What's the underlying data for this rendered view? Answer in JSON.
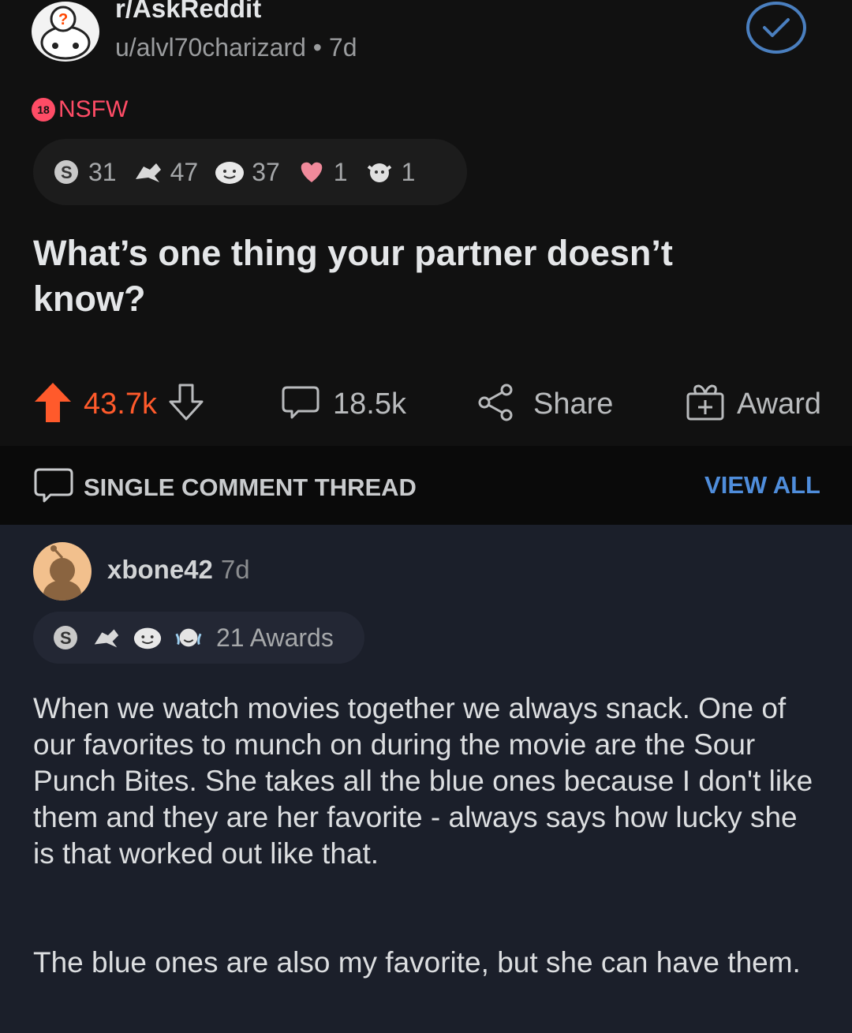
{
  "post": {
    "subreddit": "r/AskReddit",
    "author": "u/alvl70charizard",
    "separator": "•",
    "age": "7d",
    "nsfw_badge": "18",
    "nsfw_label": "NSFW",
    "awards": [
      {
        "icon": "silver-award-icon",
        "count": "31"
      },
      {
        "icon": "helpful-award-icon",
        "count": "47"
      },
      {
        "icon": "wholesome-award-icon",
        "count": "37"
      },
      {
        "icon": "heart-eyes-award-icon",
        "count": "1"
      },
      {
        "icon": "hugz-award-icon",
        "count": "1"
      }
    ],
    "title": "What’s one thing your partner doesn’t know?",
    "upvotes": "43.7k",
    "comments": "18.5k",
    "share_label": "Share",
    "award_label": "Award"
  },
  "thread": {
    "label": "SINGLE COMMENT THREAD",
    "view_all": "VIEW ALL"
  },
  "comment": {
    "username": "xbone42",
    "age": "7d",
    "awards_label": "21 Awards",
    "paragraphs": [
      "When we watch movies together we always snack. One of our favorites to munch on during the movie are the Sour Punch Bites. She takes all the blue ones because I don't like them and they are her favorite - always says how lucky she is that worked out like that.",
      "The blue ones are also my favorite, but she can have them."
    ]
  },
  "colors": {
    "upvote": "#ff5a2b",
    "nsfw": "#ff4c66",
    "link": "#4f8ddb",
    "post_bg": "#111111",
    "comment_bg": "#1b1f2a"
  }
}
